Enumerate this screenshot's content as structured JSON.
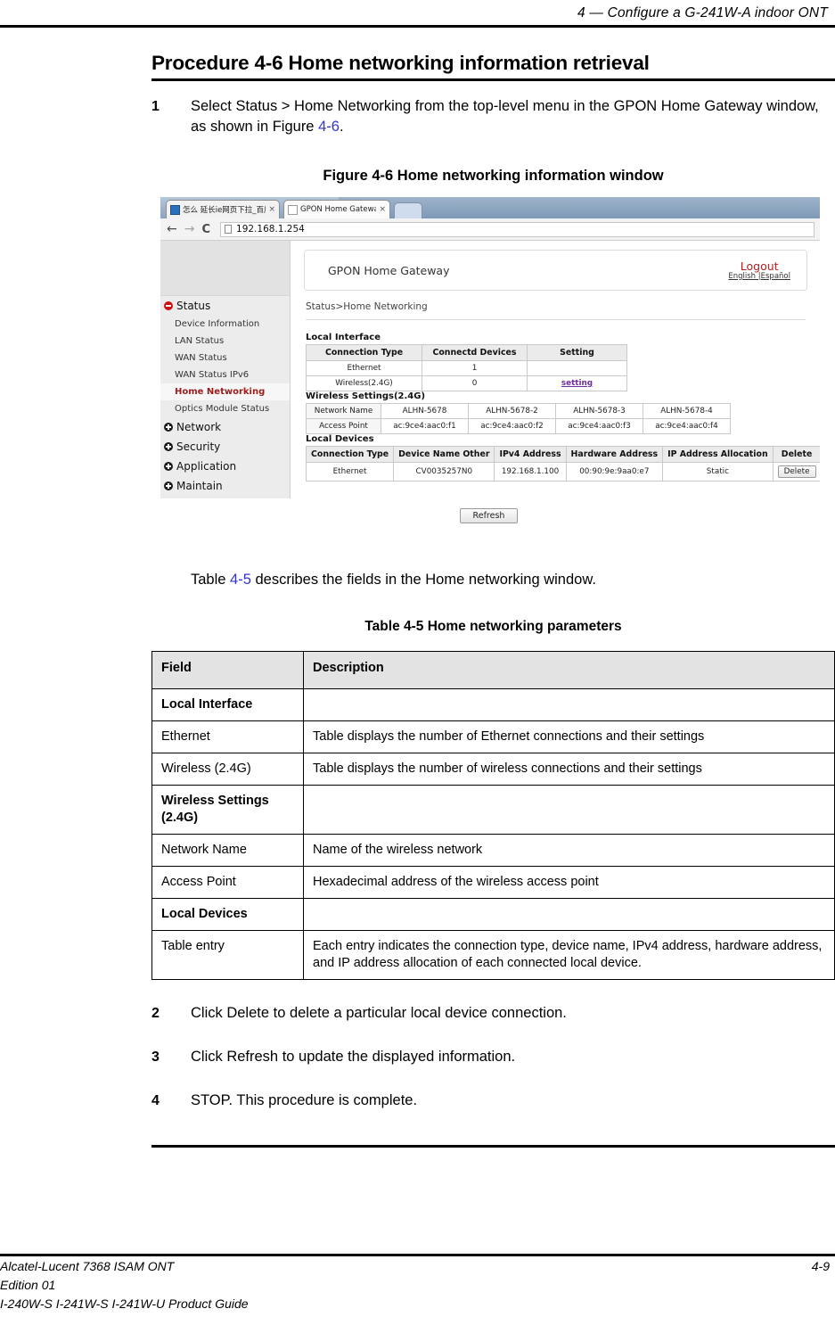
{
  "header": {
    "chapter_title": "4 —  Configure a G-241W-A indoor ONT"
  },
  "procedure": {
    "title": "Procedure 4-6  Home networking information retrieval",
    "step1": {
      "num": "1",
      "text_before": "Select Status > Home Networking from the top-level menu in the GPON Home Gateway window, as shown in Figure ",
      "xref": "4-6",
      "text_after": "."
    }
  },
  "figure": {
    "caption": "Figure 4-6  Home networking information window",
    "browser": {
      "tabs": [
        {
          "label": "怎么 延长ie网页下拉_百度",
          "close": "×"
        },
        {
          "label": "GPON Home Gateway",
          "close": "×"
        }
      ],
      "nav": {
        "back": "←",
        "forward": "→",
        "reload": "C"
      },
      "address": "192.168.1.254"
    },
    "app": {
      "title": "GPON Home Gateway",
      "logout": "Logout",
      "languages": "English |Español",
      "breadcrumb": "Status>Home Networking",
      "sidebar": [
        {
          "label": "Status",
          "type": "group",
          "icon": "minus-circle-icon",
          "state": "expanded"
        },
        {
          "label": "Device Information",
          "type": "item"
        },
        {
          "label": "LAN Status",
          "type": "item"
        },
        {
          "label": "WAN Status",
          "type": "item"
        },
        {
          "label": "WAN Status IPv6",
          "type": "item"
        },
        {
          "label": "Home Networking",
          "type": "item",
          "active": true
        },
        {
          "label": "Optics Module Status",
          "type": "item"
        },
        {
          "label": "Network",
          "type": "group",
          "icon": "plus-circle-icon",
          "state": "collapsed"
        },
        {
          "label": "Security",
          "type": "group",
          "icon": "plus-circle-icon",
          "state": "collapsed"
        },
        {
          "label": "Application",
          "type": "group",
          "icon": "plus-circle-icon",
          "state": "collapsed"
        },
        {
          "label": "Maintain",
          "type": "group",
          "icon": "plus-circle-icon",
          "state": "collapsed"
        }
      ],
      "local_interface": {
        "title": "Local Interface",
        "headers": [
          "Connection Type",
          "Connectd Devices",
          "Setting"
        ],
        "rows": [
          {
            "type": "Ethernet",
            "devices": "1",
            "setting": ""
          },
          {
            "type": "Wireless(2.4G)",
            "devices": "0",
            "setting": "setting"
          }
        ]
      },
      "wireless_settings": {
        "title": "Wireless Settings(2.4G)",
        "rows": [
          {
            "label": "Network Name",
            "values": [
              "ALHN-5678",
              "ALHN-5678-2",
              "ALHN-5678-3",
              "ALHN-5678-4"
            ]
          },
          {
            "label": "Access Point",
            "values": [
              "ac:9ce4:aac0:f1",
              "ac:9ce4:aac0:f2",
              "ac:9ce4:aac0:f3",
              "ac:9ce4:aac0:f4"
            ]
          }
        ]
      },
      "local_devices": {
        "title": "Local Devices",
        "headers": [
          "Connection Type",
          "Device Name Other",
          "IPv4 Address",
          "Hardware Address",
          "IP Address Allocation",
          "Delete"
        ],
        "rows": [
          {
            "connection_type": "Ethernet",
            "device_name": "CV0035257N0",
            "ipv4": "192.168.1.100",
            "hardware": "00:90:9e:9aa0:e7",
            "allocation": "Static",
            "delete": "Delete"
          }
        ]
      },
      "refresh_button": "Refresh"
    }
  },
  "lead_line": {
    "before": "Table ",
    "xref": "4-5",
    "after": " describes the fields in the Home networking window."
  },
  "table": {
    "caption": "Table 4-5 Home networking parameters",
    "headers": [
      "Field",
      "Description"
    ],
    "rows": [
      {
        "kind": "section",
        "field": "Local Interface",
        "description": ""
      },
      {
        "kind": "data",
        "field": "Ethernet",
        "description": "Table displays the number of Ethernet connections and their settings"
      },
      {
        "kind": "data",
        "field": "Wireless (2.4G)",
        "description": "Table displays the number of wireless connections and their settings"
      },
      {
        "kind": "section",
        "field": "Wireless Settings (2.4G)",
        "description": ""
      },
      {
        "kind": "data",
        "field": "Network Name",
        "description": "Name of the wireless network"
      },
      {
        "kind": "data",
        "field": "Access Point",
        "description": "Hexadecimal address of the wireless access point"
      },
      {
        "kind": "section",
        "field": "Local Devices",
        "description": ""
      },
      {
        "kind": "data",
        "field": "Table entry",
        "description": "Each entry indicates the connection type, device name, IPv4 address, hardware address, and IP address allocation of each connected local device."
      }
    ]
  },
  "steps_tail": [
    {
      "num": "2",
      "text": "Click Delete to delete a particular local device connection."
    },
    {
      "num": "3",
      "text": "Click Refresh to update the displayed information."
    },
    {
      "num": "4",
      "text": "STOP. This procedure is complete."
    }
  ],
  "footer": {
    "line1_left": "Alcatel-Lucent 7368 ISAM ONT",
    "page_number": "4-9",
    "line2": "Edition 01",
    "line3": "I-240W-S I-241W-S I-241W-U Product Guide"
  }
}
